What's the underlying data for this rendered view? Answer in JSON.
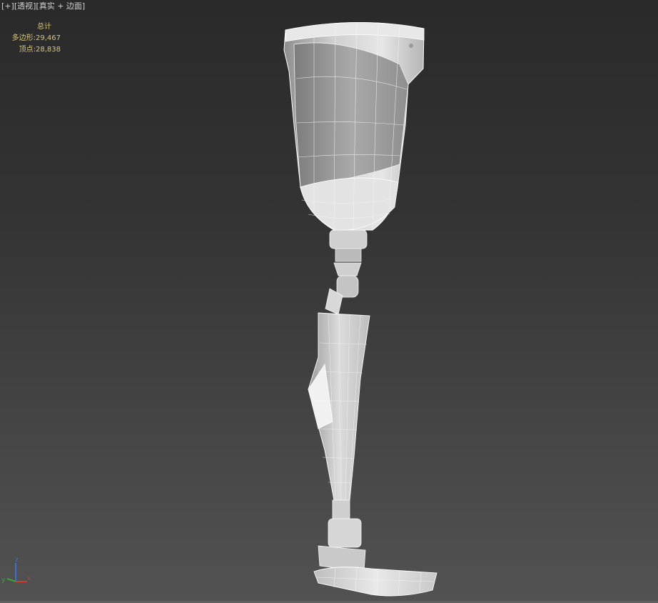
{
  "viewport": {
    "labels": {
      "plus": "[+]",
      "view": "[透视]",
      "shading": "[真实 + 边面]"
    },
    "stats": {
      "total_label": "总计",
      "polygons_label": "多边形:",
      "polygons_value": "29,467",
      "vertices_label": "顶点:",
      "vertices_value": "28,838"
    },
    "axis": {
      "z": "z",
      "x": "x",
      "y": "y"
    }
  },
  "colors": {
    "stats_text": "#d8c77a",
    "label_text": "#d2d2d2",
    "axis_x": "#d23a2a",
    "axis_y": "#3aa53a",
    "axis_z": "#3a6fd8"
  },
  "icons": {
    "axis_gizmo": "xyz-axis-icon"
  }
}
